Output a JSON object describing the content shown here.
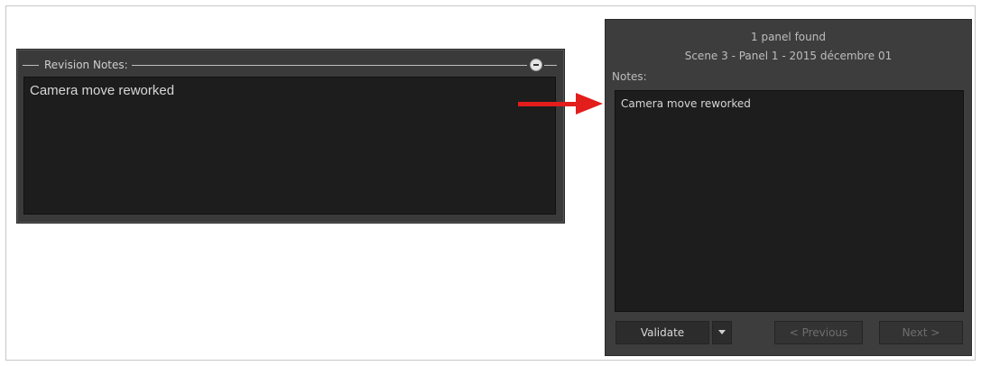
{
  "revision_panel": {
    "title": "Revision Notes:",
    "note_text": "Camera move reworked"
  },
  "dialog": {
    "found_text": "1 panel found",
    "scene_info": "Scene 3 - Panel 1 - 2015 décembre 01",
    "notes_label": "Notes:",
    "notes_text": "Camera move reworked",
    "buttons": {
      "validate": "Validate",
      "previous": "< Previous",
      "next": "Next >"
    }
  },
  "colors": {
    "arrow": "#e31c1c",
    "panel_bg": "#3d3d3d",
    "text_area_bg": "#1d1d1d"
  },
  "icons": {
    "collapse": "minus-circle-icon",
    "dropdown": "chevron-down-icon",
    "arrow": "right-arrow-icon"
  }
}
